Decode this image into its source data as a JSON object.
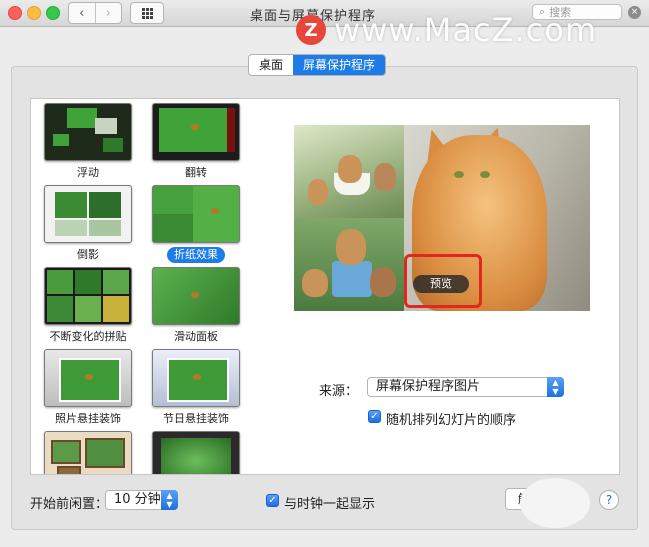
{
  "window": {
    "title": "桌面与屏幕保护程序"
  },
  "toolbar": {
    "back_glyph": "‹",
    "forward_glyph": "›"
  },
  "search": {
    "placeholder": "搜索",
    "icon": "search-icon",
    "clear_glyph": "×"
  },
  "watermark": {
    "logo_letter": "Z",
    "text": "www.MacZ.com"
  },
  "tabs": [
    {
      "label": "桌面",
      "active": false
    },
    {
      "label": "屏幕保护程序",
      "active": true
    }
  ],
  "screensavers": [
    {
      "label": "浮动",
      "selected": false
    },
    {
      "label": "翻转",
      "selected": false
    },
    {
      "label": "倒影",
      "selected": false
    },
    {
      "label": "折纸效果",
      "selected": true
    },
    {
      "label": "不断变化的拼贴",
      "selected": false
    },
    {
      "label": "滑动面板",
      "selected": false
    },
    {
      "label": "照片悬挂装饰",
      "selected": false
    },
    {
      "label": "节日悬挂装饰",
      "selected": false
    }
  ],
  "preview": {
    "button_label": "预览"
  },
  "source": {
    "label": "来源：",
    "value": "屏幕保护程序图片"
  },
  "shuffle": {
    "label": "随机排列幻灯片的顺序",
    "checked": true
  },
  "idle": {
    "label": "开始前闲置：",
    "value": "10 分钟"
  },
  "show_clock": {
    "label": "与时钟一起显示",
    "checked": true
  },
  "hot_corners": {
    "label": "触发"
  },
  "help": {
    "label": "?"
  },
  "colors": {
    "accent": "#1d7ce8",
    "highlight": "#e0281c"
  }
}
